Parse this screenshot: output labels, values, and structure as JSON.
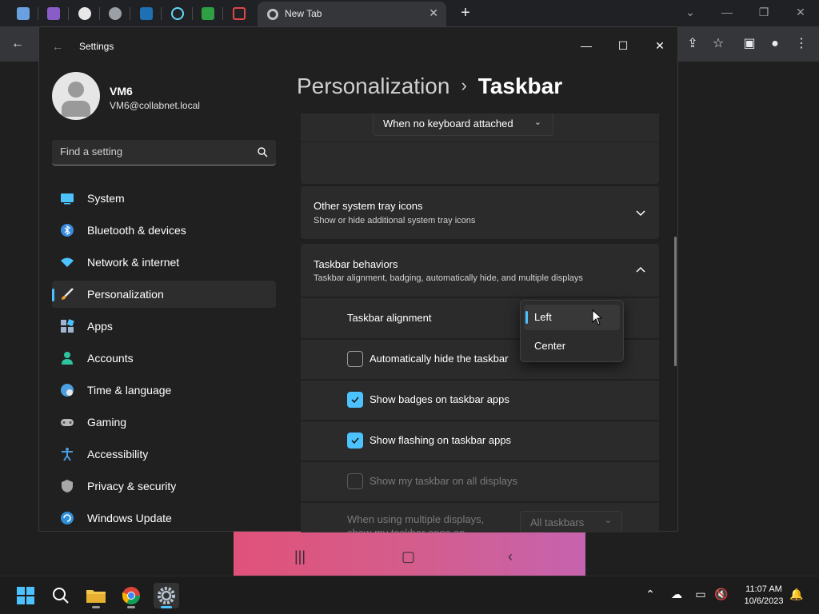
{
  "browser": {
    "tab_title": "New Tab",
    "new_tab_symbol": "+",
    "close_symbol": "✕"
  },
  "settings": {
    "window_title": "Settings",
    "user": {
      "name": "VM6",
      "email": "VM6@collabnet.local"
    },
    "search": {
      "placeholder": "Find a setting"
    },
    "nav": [
      {
        "label": "System",
        "icon": "system-icon",
        "active": false
      },
      {
        "label": "Bluetooth & devices",
        "icon": "bluetooth-icon",
        "active": false
      },
      {
        "label": "Network & internet",
        "icon": "wifi-icon",
        "active": false
      },
      {
        "label": "Personalization",
        "icon": "brush-icon",
        "active": true
      },
      {
        "label": "Apps",
        "icon": "apps-icon",
        "active": false
      },
      {
        "label": "Accounts",
        "icon": "person-icon",
        "active": false
      },
      {
        "label": "Time & language",
        "icon": "globe-icon",
        "active": false
      },
      {
        "label": "Gaming",
        "icon": "controller-icon",
        "active": false
      },
      {
        "label": "Accessibility",
        "icon": "accessibility-icon",
        "active": false
      },
      {
        "label": "Privacy & security",
        "icon": "shield-icon",
        "active": false
      },
      {
        "label": "Windows Update",
        "icon": "update-icon",
        "active": false
      }
    ],
    "breadcrumb": {
      "parent": "Personalization",
      "separator": "›",
      "current": "Taskbar"
    },
    "keyboard_dropdown": "When no keyboard attached",
    "other_tray": {
      "title": "Other system tray icons",
      "subtitle": "Show or hide additional system tray icons"
    },
    "behaviors": {
      "title": "Taskbar behaviors",
      "subtitle": "Taskbar alignment, badging, automatically hide, and multiple displays",
      "alignment_label": "Taskbar alignment",
      "alignment_options": [
        "Left",
        "Center"
      ],
      "alignment_selected": "Left",
      "autohide": {
        "label": "Automatically hide the taskbar",
        "checked": false
      },
      "badges": {
        "label": "Show badges on taskbar apps",
        "checked": true
      },
      "flashing": {
        "label": "Show flashing on taskbar apps",
        "checked": true
      },
      "all_displays": {
        "label": "Show my taskbar on all displays",
        "checked": false,
        "disabled": true
      },
      "multi_display_label": "When using multiple displays, show my taskbar apps on",
      "multi_display_value": "All taskbars"
    }
  },
  "taskbar": {
    "time": "11:07 AM",
    "date": "10/6/2023"
  },
  "colors": {
    "accent": "#4cc2ff",
    "window_bg": "#202020",
    "card_bg": "#2b2b2b"
  }
}
